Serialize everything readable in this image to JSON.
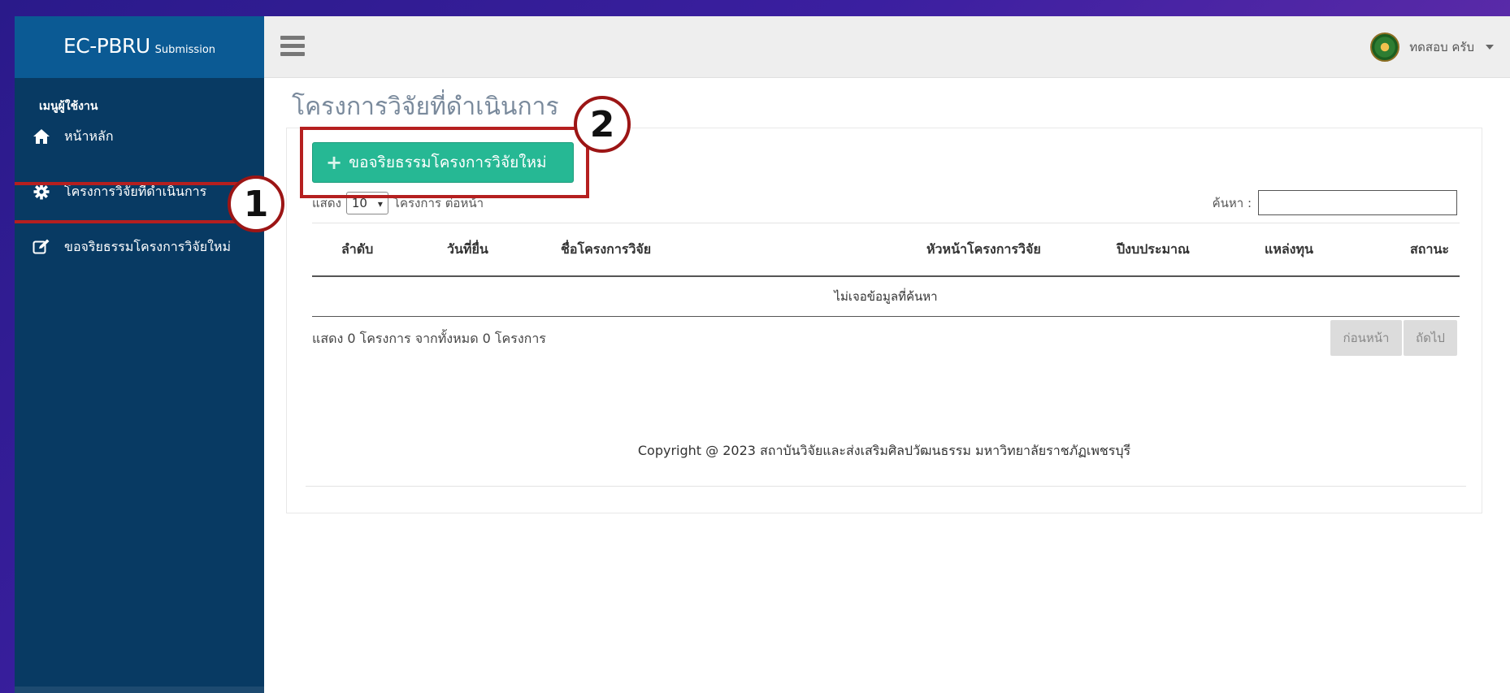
{
  "brand": {
    "main": "EC-PBRU",
    "sub": "Submission"
  },
  "sidebar": {
    "header": "เมนูผู้ใช้งาน",
    "items": [
      {
        "label": "หน้าหลัก",
        "icon": "home-icon"
      },
      {
        "label": "โครงการวิจัยที่ดำเนินการ",
        "icon": "gear-icon"
      },
      {
        "label": "ขอจริยธรรมโครงการวิจัยใหม่",
        "icon": "edit-icon"
      }
    ]
  },
  "topbar": {
    "user_name": "ทดสอบ ครับ"
  },
  "main": {
    "title": "โครงการวิจัยที่ดำเนินการ",
    "new_button": "ขอจริยธรรมโครงการวิจัยใหม่",
    "length": {
      "prefix": "แสดง",
      "value": "10",
      "suffix": "โครงการ ต่อหน้า"
    },
    "search_label": "ค้นหา :",
    "table": {
      "columns": [
        "ลำดับ",
        "วันที่ยื่น",
        "ชื่อโครงการวิจัย",
        "หัวหน้าโครงการวิจัย",
        "ปีงบประมาณ",
        "แหล่งทุน",
        "สถานะ"
      ],
      "empty": "ไม่เจอข้อมูลที่ค้นหา"
    },
    "info": "แสดง 0 โครงการ จากทั้งหมด 0 โครงการ",
    "pager": {
      "prev": "ก่อนหน้า",
      "next": "ถัดไป"
    },
    "copyright": "Copyright @ 2023 สถาบันวิจัยและส่งเสริมศิลปวัฒนธรรม มหาวิทยาลัยราชภัฏเพชรบุรี"
  },
  "annotations": {
    "one": "1",
    "two": "2",
    "color": "#b51f1f"
  }
}
